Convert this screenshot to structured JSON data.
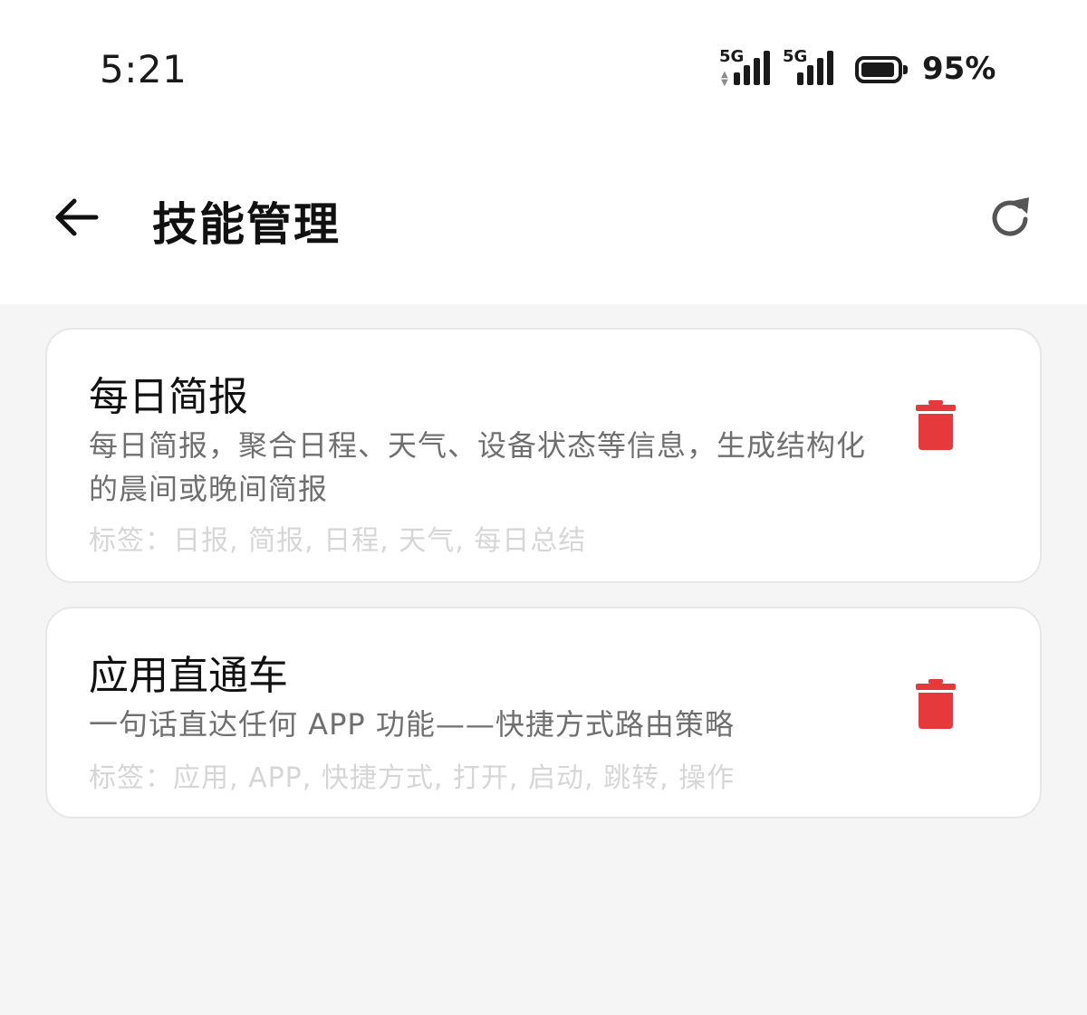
{
  "status_bar": {
    "time": "5:21",
    "signal_1_label": "5G",
    "signal_2_label": "5G",
    "battery_percent": "95%",
    "battery_level": 0.95
  },
  "app_bar": {
    "title": "技能管理",
    "back_icon": "arrow-left-icon",
    "refresh_icon": "refresh-icon"
  },
  "skills": [
    {
      "title": "每日简报",
      "description": "每日简报，聚合日程、天气、设备状态等信息，生成结构化的晨间或晚间简报",
      "tags": "标签：日报, 简报, 日程, 天气, 每日总结",
      "delete_icon": "trash-icon"
    },
    {
      "title": "应用直通车",
      "description": "一句话直达任何 APP 功能——快捷方式路由策略",
      "tags": "标签：应用, APP, 快捷方式, 打开, 启动, 跳转, 操作",
      "delete_icon": "trash-icon"
    }
  ],
  "colors": {
    "delete_red": "#e5393b",
    "page_bg": "#f5f5f5",
    "card_bg": "#ffffff",
    "muted_text": "#6f6f6f",
    "tag_text": "#d6d6d6"
  }
}
